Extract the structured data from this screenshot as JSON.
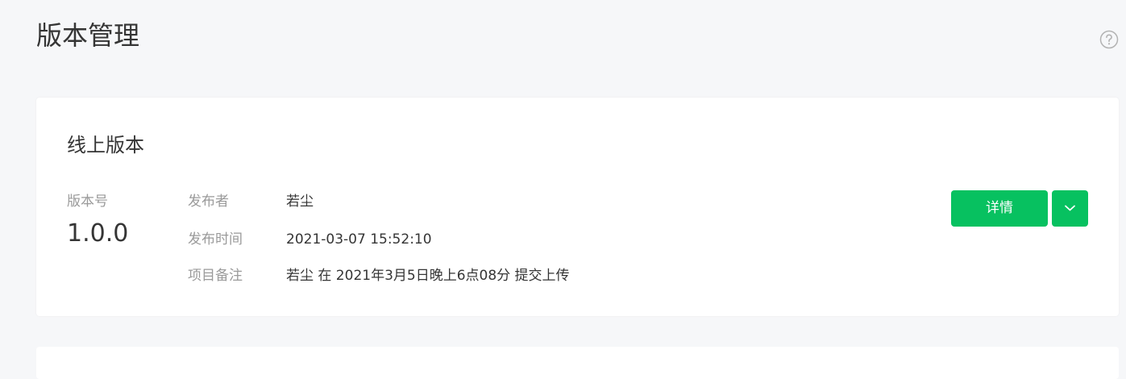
{
  "page": {
    "title": "版本管理"
  },
  "online_version": {
    "section_title": "线上版本",
    "version_label": "版本号",
    "version_value": "1.0.0",
    "publisher_label": "发布者",
    "publisher_value": "若尘",
    "publish_time_label": "发布时间",
    "publish_time_value": "2021-03-07 15:52:10",
    "remark_label": "项目备注",
    "remark_value": "若尘 在 2021年3月5日晚上6点08分 提交上传",
    "detail_button_label": "详情",
    "more_button_icon": "chevron-down-icon"
  },
  "icons": {
    "help": "question-circle-icon"
  },
  "colors": {
    "accent": "#07c160",
    "background": "#f6f7f9",
    "card": "#ffffff",
    "text_primary": "#353535",
    "text_secondary": "#9a9a9a"
  }
}
